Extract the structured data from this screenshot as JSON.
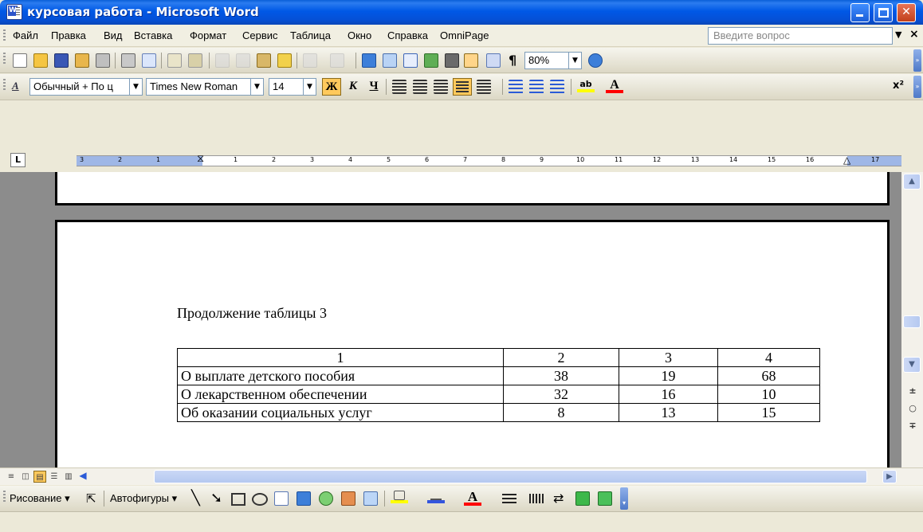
{
  "window": {
    "title": "курсовая работа - Microsoft Word",
    "minimize_symbol": "",
    "maximize_symbol": "",
    "close_symbol": "✕"
  },
  "menu": {
    "items": [
      "Файл",
      "Правка",
      "Вид",
      "Вставка",
      "Формат",
      "Сервис",
      "Таблица",
      "Окно",
      "Справка",
      "OmniPage"
    ],
    "ask_placeholder": "Введите вопрос",
    "ask_arrow": "▼",
    "close_doc": "×"
  },
  "standard_toolbar": {
    "icons": [
      "new-icon",
      "open-icon",
      "save-icon",
      "permission-icon",
      "print-icon",
      "print-preview-icon",
      "spelling-icon",
      "research-icon",
      "cut-icon",
      "copy-icon",
      "paste-icon",
      "format-painter-icon",
      "undo-icon",
      "redo-icon",
      "hyperlink-icon",
      "tables-borders-icon",
      "insert-table-icon",
      "insert-excel-icon",
      "columns-icon",
      "drawing-icon",
      "document-map-icon",
      "show-formatting-icon",
      "help-icon"
    ],
    "zoom": "80%",
    "pilcrow": "¶"
  },
  "formatting_toolbar": {
    "style": "Обычный + По ц",
    "font": "Times New Roman",
    "size": "14",
    "bold": "Ж",
    "italic": "К",
    "underline": "Ч",
    "superscript": "x²",
    "active_alignment": "justify",
    "highlight_color": "#ffff00",
    "font_color": "#ff0000"
  },
  "ruler": {
    "tab_stop": "L",
    "left_numbers": [
      "3",
      "2",
      "1"
    ],
    "right_numbers": [
      "1",
      "2",
      "3",
      "4",
      "5",
      "6",
      "7",
      "8",
      "9",
      "10",
      "11",
      "12",
      "13",
      "14",
      "15",
      "16",
      "17"
    ]
  },
  "document": {
    "caption": "Продолжение таблицы 3",
    "table": {
      "header": [
        "1",
        "2",
        "3",
        "4"
      ],
      "rows": [
        [
          "О выплате детского пособия",
          "38",
          "19",
          "68"
        ],
        [
          "О лекарственном обеспечении",
          "32",
          "16",
          "10"
        ],
        [
          "Об оказании социальных услуг",
          "8",
          "13",
          "15"
        ]
      ]
    }
  },
  "view_buttons": [
    "normal-view-icon",
    "web-layout-icon",
    "print-layout-icon",
    "outline-view-icon",
    "reading-layout-icon"
  ],
  "drawing_toolbar": {
    "drawing_label": "Рисование ▾",
    "autoshapes_label": "Автофигуры ▾",
    "fill_color": "#ffff00",
    "line_color": "#3355dd",
    "font_color": "#ff0000"
  }
}
